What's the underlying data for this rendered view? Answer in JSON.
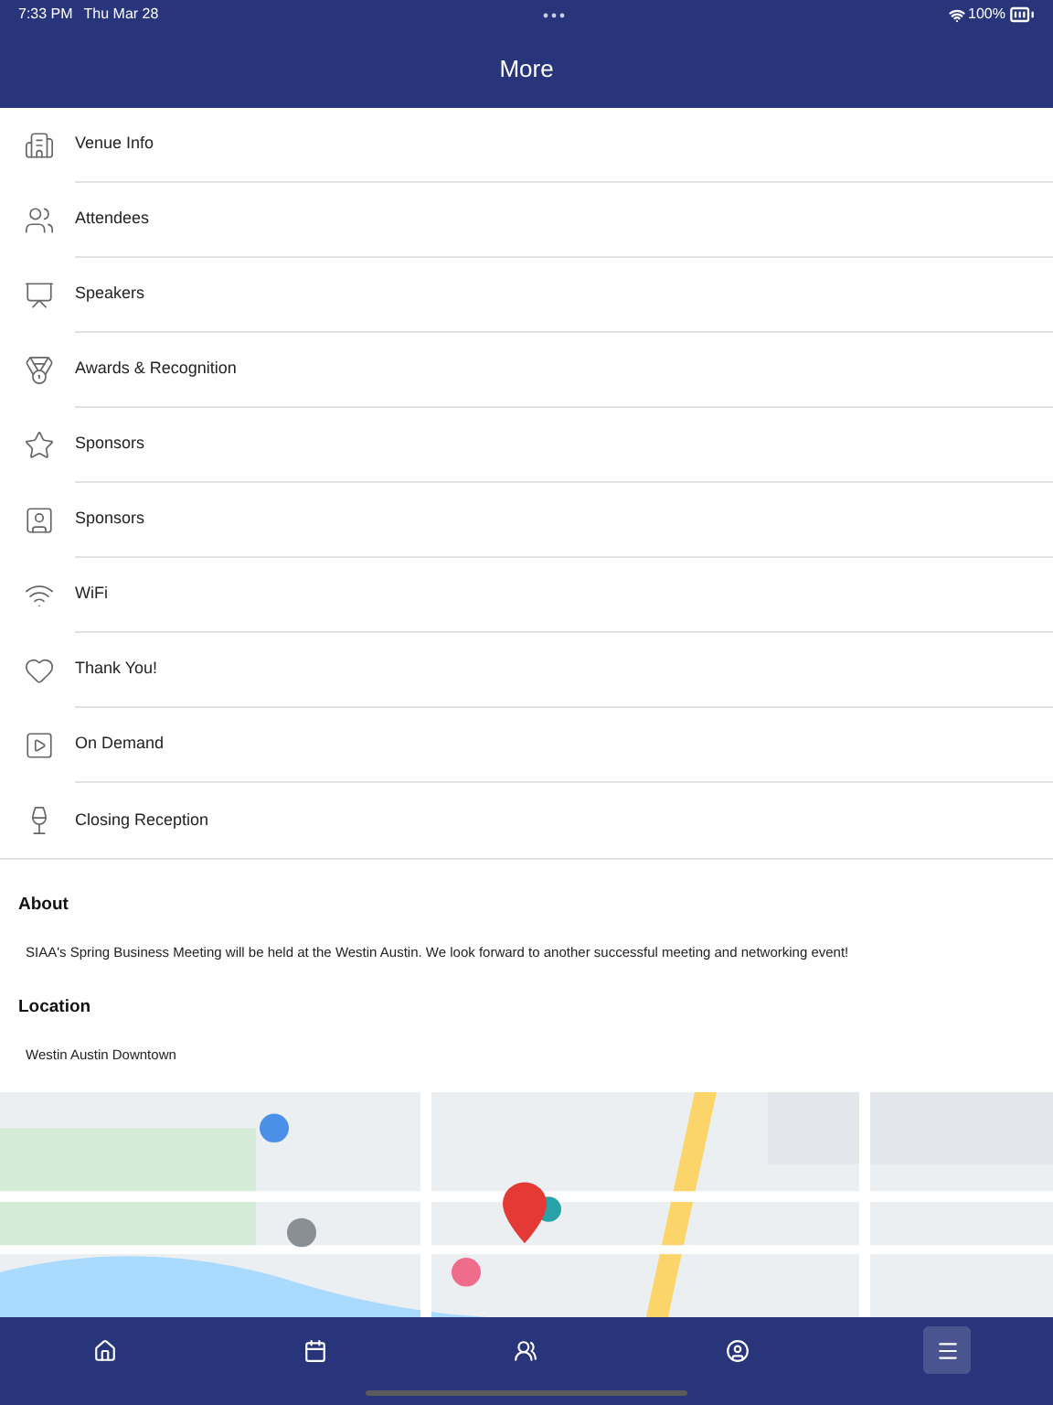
{
  "status_bar": {
    "time": "7:33 PM",
    "date": "Thu Mar 28",
    "battery": "100%"
  },
  "header": {
    "title": "More"
  },
  "menu_items": [
    {
      "label": "Venue Info",
      "kind": "building"
    },
    {
      "label": "Attendees",
      "kind": "people"
    },
    {
      "label": "Speakers",
      "kind": "speaker"
    },
    {
      "label": "Awards & Recognition",
      "kind": "medal"
    },
    {
      "label": "Sponsors",
      "kind": "star"
    },
    {
      "label": "Sponsors",
      "kind": "badge"
    },
    {
      "label": "WiFi",
      "kind": "wifi"
    },
    {
      "label": "Thank You!",
      "kind": "heart"
    },
    {
      "label": "On Demand",
      "kind": "video"
    },
    {
      "label": "Closing Reception",
      "kind": "glass"
    }
  ],
  "about": {
    "heading": "About",
    "text": "SIAA's Spring Business Meeting will be held at the Westin Austin. We look forward to another successful meeting and networking event!"
  },
  "location": {
    "heading": "Location",
    "text": "Westin Austin Downtown"
  },
  "tab_bar": [
    {
      "kind": "home",
      "selected": false
    },
    {
      "kind": "calendar",
      "selected": false
    },
    {
      "kind": "people",
      "selected": false
    },
    {
      "kind": "profile",
      "selected": false
    },
    {
      "kind": "menu",
      "selected": true
    }
  ]
}
